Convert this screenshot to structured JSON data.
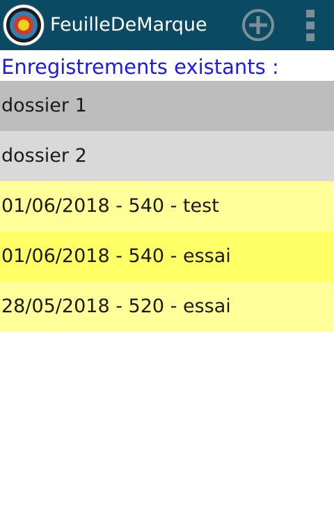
{
  "action_bar": {
    "title": "FeuilleDeMarque",
    "app_icon": "archery-target-icon",
    "add_action_icon": "add-circle-icon",
    "overflow_menu_icon": "more-vertical-icon",
    "background_color": "#0b4a63"
  },
  "section": {
    "title": "Enregistrements existants :",
    "color": "#1a1aee"
  },
  "rows": [
    {
      "label": "dossier 1",
      "kind": "folder",
      "color": "#bdbdbd"
    },
    {
      "label": "dossier 2",
      "kind": "folder",
      "color": "#d9d9d9"
    },
    {
      "label": "01/06/2018 - 540 - test",
      "kind": "record",
      "color": "#ffff99"
    },
    {
      "label": "01/06/2018 - 540 - essai",
      "kind": "record",
      "color": "#ffff66"
    },
    {
      "label": "28/05/2018 - 520 - essai",
      "kind": "record",
      "color": "#ffff99"
    }
  ]
}
